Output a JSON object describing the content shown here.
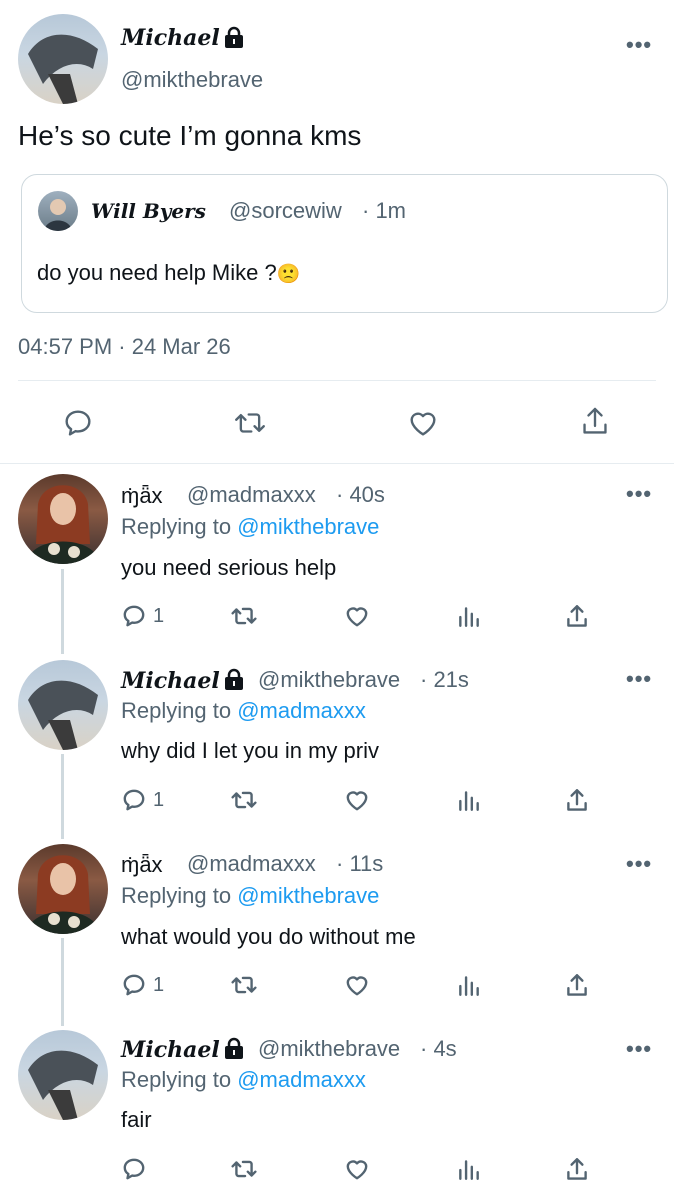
{
  "main_tweet": {
    "author_name": "Michael",
    "author_handle": "@mikthebrave",
    "lock_icon": "lock-icon",
    "text": "He’s so cute I’m gonna kms",
    "timestamp": "04:57 PM · 24 Mar 26",
    "quote": {
      "author_name": "Will Byers",
      "author_handle": "@sorcewiw",
      "time": "· 1m",
      "text": "do you need help Mike ?",
      "emoji": "🙁"
    },
    "actions": [
      "reply-icon",
      "retweet-icon",
      "like-icon",
      "share-icon"
    ]
  },
  "replies": [
    {
      "author_name": "ɱ̇ǟx",
      "author_handle": "@madmaxxx",
      "time": "· 40s",
      "replying_prefix": "Replying to",
      "replying_to": "@mikthebrave",
      "text": "you need serious help",
      "reply_count": "1"
    },
    {
      "author_name": "Michael",
      "author_handle": "@mikthebrave",
      "time": "· 21s",
      "replying_prefix": "Replying to",
      "replying_to": "@madmaxxx",
      "text": "why did I let you in my priv",
      "reply_count": "1"
    },
    {
      "author_name": "ɱ̇ǟx",
      "author_handle": "@madmaxxx",
      "time": "· 11s",
      "replying_prefix": "Replying to",
      "replying_to": "@mikthebrave",
      "text": "what would you do without me",
      "reply_count": "1"
    },
    {
      "author_name": "Michael",
      "author_handle": "@mikthebrave",
      "time": "· 4s",
      "replying_prefix": "Replying to",
      "replying_to": "@madmaxxx",
      "text": "fair",
      "reply_count": ""
    }
  ],
  "more_icon": "•••",
  "colors": {
    "accent": "#1d9bf0",
    "secondary": "#536471",
    "border": "#cfd9de"
  }
}
